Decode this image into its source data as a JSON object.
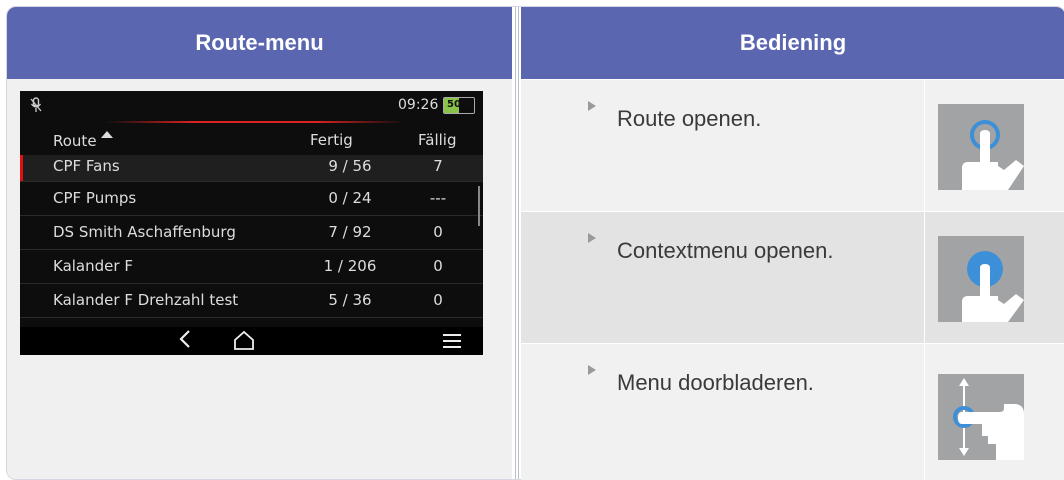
{
  "headers": {
    "left": "Route-menu",
    "right": "Bediening"
  },
  "device": {
    "status": {
      "mic_icon": "mic-off-icon",
      "time": "09:26",
      "battery": "50%"
    },
    "columns": {
      "route": "Route",
      "fertig": "Fertig",
      "faellig": "Fällig"
    },
    "rows": [
      {
        "route": "CPF Fans",
        "fertig": "9 / 56",
        "faellig": "7"
      },
      {
        "route": "CPF Pumps",
        "fertig": "0 / 24",
        "faellig": "---"
      },
      {
        "route": "DS Smith Aschaffenburg",
        "fertig": "7 / 92",
        "faellig": "0"
      },
      {
        "route": "Kalander F",
        "fertig": "1 / 206",
        "faellig": "0"
      },
      {
        "route": "Kalander F Drehzahl test",
        "fertig": "5 / 36",
        "faellig": "0"
      }
    ],
    "nav": {
      "back_icon": "back-icon",
      "home_icon": "home-icon",
      "menu_icon": "menu-icon"
    }
  },
  "operations": [
    {
      "text": "Route openen.",
      "icon": "tap-icon"
    },
    {
      "text": "Contextmenu openen.",
      "icon": "long-press-icon"
    },
    {
      "text": "Menu doorbladeren.",
      "icon": "swipe-vertical-icon"
    }
  ],
  "colors": {
    "header": "#5a66b0",
    "accent_red": "#e01010",
    "icon_blue": "#3d8fd8"
  }
}
